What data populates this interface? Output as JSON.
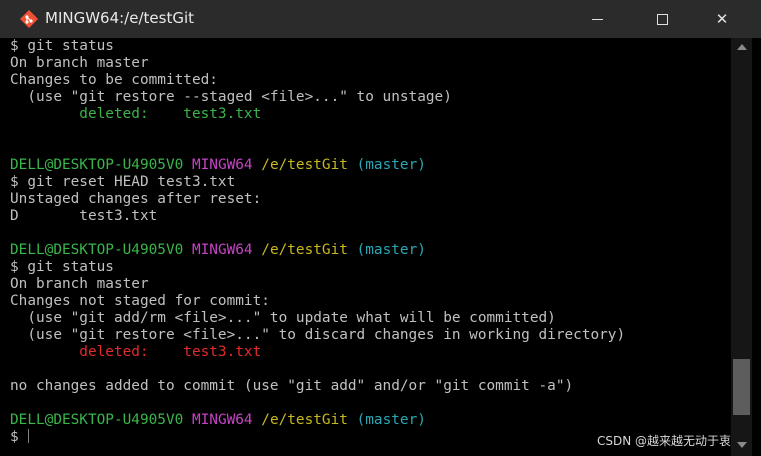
{
  "window": {
    "title": "MINGW64:/e/testGit",
    "icon": "git-bash-icon",
    "controls": {
      "minimize": "minimize-icon",
      "maximize": "maximize-icon",
      "close": "close-icon",
      "close_glyph": "✕"
    }
  },
  "colors": {
    "background": "#000000",
    "text": "#c0c0c0",
    "green": "#39b54a",
    "red": "#e32b2b",
    "magenta": "#c643c6",
    "yellow": "#c8b820",
    "cyan": "#2aa7b5"
  },
  "terminal": {
    "lines": [
      [
        {
          "t": "$ git status",
          "c": "white"
        }
      ],
      [
        {
          "t": "On branch master",
          "c": "white"
        }
      ],
      [
        {
          "t": "Changes to be committed:",
          "c": "white"
        }
      ],
      [
        {
          "t": "  (use \"git restore --staged <file>...\" to unstage)",
          "c": "white"
        }
      ],
      [
        {
          "t": "\tdeleted:    test3.txt",
          "c": "green"
        }
      ],
      [],
      [],
      [
        {
          "t": "DELL@DESKTOP-U4905V0",
          "c": "green"
        },
        {
          "t": " ",
          "c": "white"
        },
        {
          "t": "MINGW64",
          "c": "magenta"
        },
        {
          "t": " ",
          "c": "white"
        },
        {
          "t": "/e/testGit",
          "c": "yellow"
        },
        {
          "t": " ",
          "c": "white"
        },
        {
          "t": "(master)",
          "c": "cyan"
        }
      ],
      [
        {
          "t": "$ git reset HEAD test3.txt",
          "c": "white"
        }
      ],
      [
        {
          "t": "Unstaged changes after reset:",
          "c": "white"
        }
      ],
      [
        {
          "t": "D\ttest3.txt",
          "c": "white"
        }
      ],
      [],
      [
        {
          "t": "DELL@DESKTOP-U4905V0",
          "c": "green"
        },
        {
          "t": " ",
          "c": "white"
        },
        {
          "t": "MINGW64",
          "c": "magenta"
        },
        {
          "t": " ",
          "c": "white"
        },
        {
          "t": "/e/testGit",
          "c": "yellow"
        },
        {
          "t": " ",
          "c": "white"
        },
        {
          "t": "(master)",
          "c": "cyan"
        }
      ],
      [
        {
          "t": "$ git status",
          "c": "white"
        }
      ],
      [
        {
          "t": "On branch master",
          "c": "white"
        }
      ],
      [
        {
          "t": "Changes not staged for commit:",
          "c": "white"
        }
      ],
      [
        {
          "t": "  (use \"git add/rm <file>...\" to update what will be committed)",
          "c": "white"
        }
      ],
      [
        {
          "t": "  (use \"git restore <file>...\" to discard changes in working directory)",
          "c": "white"
        }
      ],
      [
        {
          "t": "\tdeleted:    test3.txt",
          "c": "red"
        }
      ],
      [],
      [
        {
          "t": "no changes added to commit (use \"git add\" and/or \"git commit -a\")",
          "c": "white"
        }
      ],
      [],
      [
        {
          "t": "DELL@DESKTOP-U4905V0",
          "c": "green"
        },
        {
          "t": " ",
          "c": "white"
        },
        {
          "t": "MINGW64",
          "c": "magenta"
        },
        {
          "t": " ",
          "c": "white"
        },
        {
          "t": "/e/testGit",
          "c": "yellow"
        },
        {
          "t": " ",
          "c": "white"
        },
        {
          "t": "(master)",
          "c": "cyan"
        }
      ]
    ],
    "prompt": "$"
  },
  "scrollbar": {
    "up_icon": "scroll-up-arrow-icon",
    "down_icon": "scroll-down-arrow-icon",
    "position": 0.93
  },
  "watermark": "CSDN @越来越无动于衷"
}
